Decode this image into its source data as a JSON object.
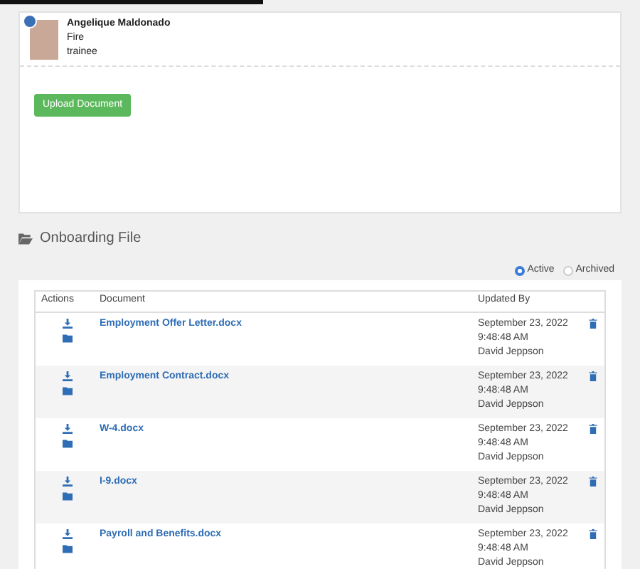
{
  "profile": {
    "name": "Angelique Maldonado",
    "department": "Fire",
    "role": "trainee"
  },
  "upload_button": "Upload Document",
  "section": {
    "title": "Onboarding File"
  },
  "filter": [
    {
      "label": "Active",
      "selected": true
    },
    {
      "label": "Archived",
      "selected": false
    }
  ],
  "table": {
    "columns": [
      "Actions",
      "Document",
      "Updated By"
    ],
    "rows": [
      {
        "document": "Employment Offer Letter.docx",
        "date": "September 23, 2022",
        "time": "9:48:48 AM",
        "user": "David Jeppson"
      },
      {
        "document": "Employment Contract.docx",
        "date": "September 23, 2022",
        "time": "9:48:48 AM",
        "user": "David Jeppson"
      },
      {
        "document": "W-4.docx",
        "date": "September 23, 2022",
        "time": "9:48:48 AM",
        "user": "David Jeppson"
      },
      {
        "document": "I-9.docx",
        "date": "September 23, 2022",
        "time": "9:48:48 AM",
        "user": "David Jeppson"
      },
      {
        "document": "Payroll and Benefits.docx",
        "date": "September 23, 2022",
        "time": "9:48:48 AM",
        "user": "David Jeppson"
      }
    ]
  }
}
